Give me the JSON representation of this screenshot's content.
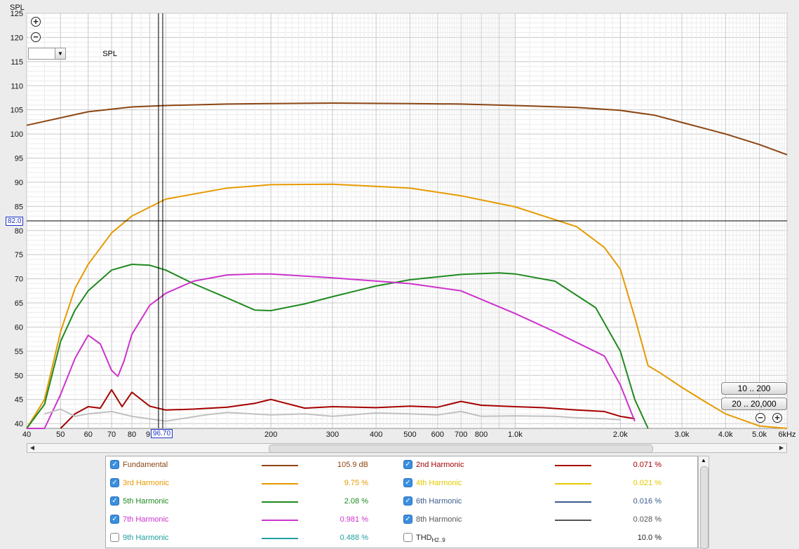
{
  "chart_data": {
    "type": "line",
    "ylabel": "SPL",
    "xlabel": "",
    "x_scale": "log",
    "xlim": [
      40,
      6000
    ],
    "ylim": [
      39,
      125
    ],
    "x_tick_labels": [
      {
        "v": 40,
        "t": "40"
      },
      {
        "v": 50,
        "t": "50"
      },
      {
        "v": 60,
        "t": "60"
      },
      {
        "v": 70,
        "t": "70"
      },
      {
        "v": 80,
        "t": "80"
      },
      {
        "v": 200,
        "t": "200"
      },
      {
        "v": 300,
        "t": "300"
      },
      {
        "v": 400,
        "t": "400"
      },
      {
        "v": 500,
        "t": "500"
      },
      {
        "v": 600,
        "t": "600"
      },
      {
        "v": 700,
        "t": "700"
      },
      {
        "v": 800,
        "t": "800"
      },
      {
        "v": 1000,
        "t": "1.0k"
      },
      {
        "v": 2000,
        "t": "2.0k"
      },
      {
        "v": 3000,
        "t": "3.0k"
      },
      {
        "v": 4000,
        "t": "4.0k"
      },
      {
        "v": 5000,
        "t": "5.0k"
      },
      {
        "v": 6000,
        "t": "6kHz"
      }
    ],
    "y_tick_labels": [
      125,
      120,
      115,
      110,
      105,
      100,
      95,
      90,
      85,
      80,
      75,
      70,
      65,
      60,
      55,
      50,
      45,
      40
    ],
    "grid": true,
    "cursor": {
      "x": 96.7,
      "x_label": "96.70",
      "y": 82.0,
      "y_label": "82.0",
      "x_partial_label": "9"
    },
    "series": [
      {
        "name": "Fundamental",
        "color": "#8b4513",
        "x": [
          40,
          60,
          80,
          100,
          150,
          200,
          300,
          500,
          700,
          1000,
          1500,
          2000,
          2500,
          3000,
          4000,
          5000,
          6000
        ],
        "y": [
          101.8,
          104.6,
          105.6,
          105.9,
          106.2,
          106.3,
          106.4,
          106.3,
          106.2,
          105.9,
          105.5,
          104.9,
          103.9,
          102.4,
          100.0,
          97.8,
          95.7
        ]
      },
      {
        "name": "2nd Harmonic",
        "color": "#a50000",
        "x": [
          50,
          55,
          60,
          65,
          70,
          75,
          80,
          90,
          100,
          120,
          150,
          180,
          200,
          250,
          300,
          400,
          500,
          600,
          700,
          800,
          1000,
          1200,
          1500,
          1800,
          2000,
          2200
        ],
        "y": [
          38.5,
          42.0,
          43.5,
          43.2,
          47.0,
          43.5,
          46.5,
          43.6,
          42.8,
          43.0,
          43.4,
          44.2,
          45.0,
          43.2,
          43.5,
          43.3,
          43.6,
          43.4,
          44.6,
          43.8,
          43.5,
          43.3,
          42.8,
          42.5,
          41.5,
          41.0
        ]
      },
      {
        "name": "3rd Harmonic",
        "color": "#e69a00",
        "x": [
          40,
          45,
          50,
          55,
          60,
          70,
          80,
          100,
          150,
          200,
          300,
          500,
          700,
          1000,
          1500,
          1800,
          2000,
          2200,
          2400,
          2600,
          3000,
          3500,
          4000,
          5000,
          6000
        ],
        "y": [
          32,
          45,
          59,
          68,
          73,
          79.5,
          83.0,
          86.5,
          88.8,
          89.5,
          89.6,
          88.8,
          87.2,
          84.9,
          80.8,
          76.5,
          72.0,
          62.0,
          52.0,
          50.5,
          47.5,
          44.5,
          42.0,
          39.5,
          37.5
        ]
      },
      {
        "name": "5th Harmonic",
        "color": "#1f8a1f",
        "x": [
          40,
          45,
          50,
          55,
          60,
          70,
          80,
          90,
          100,
          120,
          150,
          180,
          200,
          250,
          300,
          400,
          500,
          700,
          900,
          1000,
          1300,
          1700,
          2000,
          2200,
          2400
        ],
        "y": [
          30,
          44,
          57,
          63.5,
          67.5,
          71.8,
          73.0,
          72.8,
          71.8,
          69.0,
          66.0,
          63.5,
          63.4,
          64.8,
          66.3,
          68.5,
          69.8,
          70.9,
          71.2,
          71.0,
          69.5,
          64.0,
          55.0,
          45.0,
          38.0
        ]
      },
      {
        "name": "7th Harmonic",
        "color": "#cc33cc",
        "x": [
          40,
          45,
          50,
          55,
          60,
          65,
          70,
          73,
          76,
          80,
          90,
          100,
          120,
          150,
          180,
          200,
          300,
          500,
          700,
          1000,
          1300,
          1800,
          2000,
          2200
        ],
        "y": [
          30,
          36,
          46,
          53.5,
          58.3,
          56.5,
          51.0,
          49.8,
          53.0,
          58.5,
          64.5,
          67.0,
          69.5,
          70.8,
          71.0,
          71.0,
          70.2,
          69.0,
          67.5,
          62.8,
          59.0,
          54.0,
          48.0,
          40.5
        ]
      },
      {
        "name": "8th Harmonic",
        "color": "#c0c0c0",
        "x": [
          45,
          50,
          55,
          60,
          70,
          80,
          100,
          130,
          150,
          200,
          250,
          300,
          400,
          500,
          600,
          700,
          800,
          1000,
          1300,
          1500,
          1800,
          2000
        ],
        "y": [
          42.0,
          43.0,
          41.5,
          42.0,
          42.5,
          41.5,
          40.5,
          41.8,
          42.3,
          41.8,
          42.0,
          41.5,
          42.2,
          42.0,
          41.8,
          42.5,
          41.5,
          41.6,
          41.5,
          41.2,
          41.0,
          40.8
        ]
      }
    ]
  },
  "controls": {
    "zoom_in_icon": "plus-magnifier-icon",
    "zoom_out_icon": "minus-magnifier-icon",
    "y_select": "SPL",
    "range_btn_1": "10 .. 200",
    "range_btn_2": "20 .. 20,000"
  },
  "legend": {
    "rows": [
      {
        "left": {
          "label": "Fundamental",
          "color": "#8b4513",
          "value": "105.9 dB",
          "checked": true
        },
        "right": {
          "label": "2nd Harmonic",
          "color": "#a50000",
          "value": "0.071 %",
          "checked": true
        }
      },
      {
        "left": {
          "label": "3rd Harmonic",
          "color": "#e69a00",
          "value": "9.75 %",
          "checked": true
        },
        "right": {
          "label": "4th Harmonic",
          "color": "#e6c800",
          "value": "0.021 %",
          "checked": true
        }
      },
      {
        "left": {
          "label": "5th Harmonic",
          "color": "#1f8a1f",
          "value": "2.08 %",
          "checked": true
        },
        "right": {
          "label": "6th Harmonic",
          "color": "#3b5b8c",
          "value": "0.016 %",
          "checked": true
        }
      },
      {
        "left": {
          "label": "7th Harmonic",
          "color": "#cc33cc",
          "value": "0.981 %",
          "checked": true
        },
        "right": {
          "label": "8th Harmonic",
          "color": "#555555",
          "value": "0.028 %",
          "checked": true
        }
      },
      {
        "left": {
          "label": "9th Harmonic",
          "color": "#20a0a0",
          "value": "0.488 %",
          "checked": false
        },
        "right": {
          "label": "THD",
          "label_sub": "H2..9",
          "color": "#333333",
          "value": "10.0 %",
          "checked": false
        }
      }
    ]
  }
}
